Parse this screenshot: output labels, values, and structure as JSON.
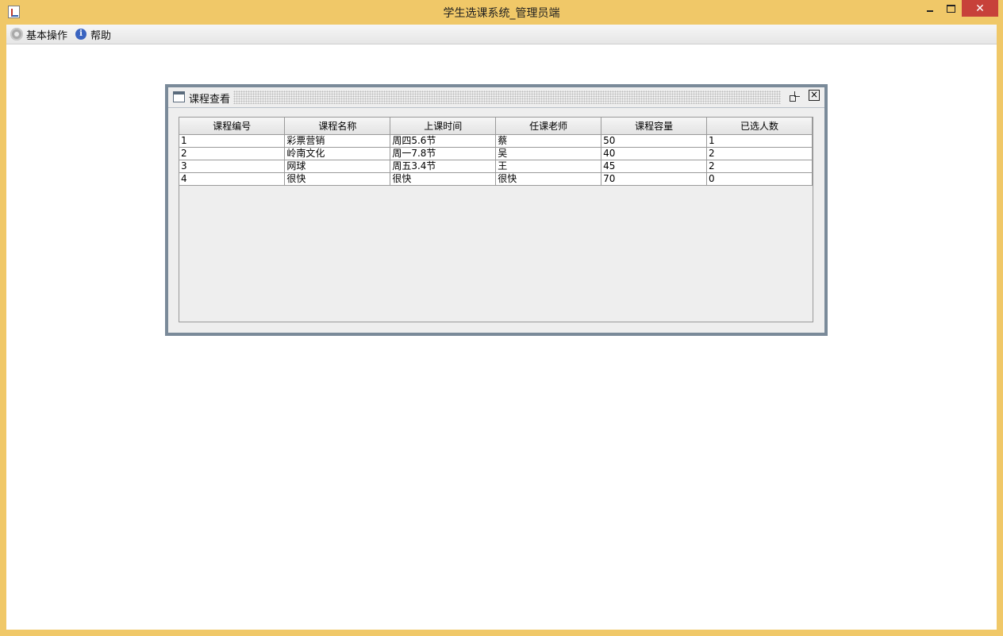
{
  "window": {
    "title": "学生选课系统_管理员端",
    "close_glyph": "✕"
  },
  "menubar": {
    "items": [
      {
        "label": "基本操作",
        "icon": "gear-icon"
      },
      {
        "label": "帮助",
        "icon": "info-icon"
      }
    ]
  },
  "internal_frame": {
    "title": "课程查看",
    "close_glyph": "×",
    "table": {
      "headers": [
        "课程编号",
        "课程名称",
        "上课时间",
        "任课老师",
        "课程容量",
        "已选人数"
      ],
      "rows": [
        [
          "1",
          "彩票营销",
          "周四5.6节",
          "蔡",
          "50",
          "1"
        ],
        [
          "2",
          "岭南文化",
          "周一7.8节",
          "吴",
          "40",
          "2"
        ],
        [
          "3",
          "网球",
          "周五3.4节",
          "王",
          "45",
          "2"
        ],
        [
          "4",
          "很快",
          "很快",
          "很快",
          "70",
          "0"
        ]
      ]
    }
  },
  "colors": {
    "window_frame": "#f0c868",
    "close_button": "#c7413a",
    "internal_frame_border": "#7a8a99"
  }
}
